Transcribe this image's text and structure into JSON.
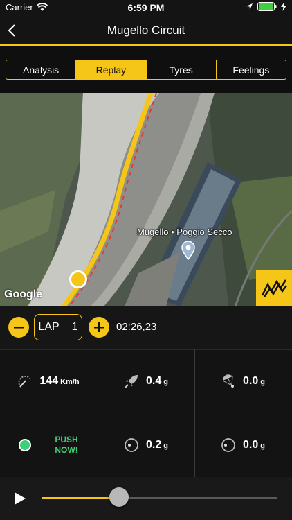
{
  "status": {
    "carrier": "Carrier",
    "time": "6:59 PM"
  },
  "nav": {
    "title": "Mugello Circuit"
  },
  "tabs": [
    {
      "label": "Analysis",
      "active": false
    },
    {
      "label": "Replay",
      "active": true
    },
    {
      "label": "Tyres",
      "active": false
    },
    {
      "label": "Feelings",
      "active": false
    }
  ],
  "map": {
    "poi_label": "Mugello • Poggio Secco",
    "attribution": "Google"
  },
  "lap": {
    "label": "LAP",
    "number": "1",
    "time": "02:26,23"
  },
  "metrics": {
    "speed": {
      "value": "144",
      "unit": "Km/h"
    },
    "accel": {
      "value": "0.4",
      "unit": "g"
    },
    "brake": {
      "value": "0.0",
      "unit": "g"
    },
    "status": {
      "text_line1": "PUSH",
      "text_line2": "NOW!"
    },
    "lateral": {
      "value": "0.2",
      "unit": "g"
    },
    "combined": {
      "value": "0.0",
      "unit": "g"
    }
  },
  "player": {
    "progress": 0.33
  },
  "colors": {
    "accent": "#f5c518",
    "status_green": "#3fcf76"
  }
}
